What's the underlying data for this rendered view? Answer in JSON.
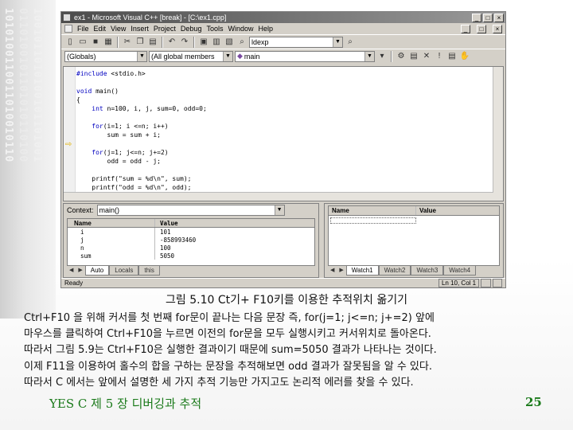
{
  "decoration": {
    "strip1": "1010100110011010010110",
    "strip2": "0110100101101010110100",
    "strip3": "1001011010100101101001"
  },
  "ide": {
    "title": "ex1 - Microsoft Visual C++ [break] - [C:\\ex1.cpp]",
    "menu": [
      "File",
      "Edit",
      "View",
      "Insert",
      "Project",
      "Debug",
      "Tools",
      "Window",
      "Help"
    ],
    "find_combo": "ldexp",
    "scope_combo": "(Globals)",
    "members_combo": "(All global members",
    "function_combo": "main",
    "code_lines": [
      "#include <stdio.h>",
      "",
      "void main()",
      "{",
      "    int n=100, i, j, sum=0, odd=0;",
      "",
      "    for(i=1; i <=n; i++)",
      "        sum = sum + i;",
      "",
      "    for(j=1; j<=n; j+=2)",
      "        odd = odd - j;",
      "",
      "    printf(\"sum = %d\\n\", sum);",
      "    printf(\"odd = %d\\n\", odd);"
    ],
    "context_label": "Context:",
    "context_value": "main()",
    "vars_headers": [
      "Name",
      "Value"
    ],
    "vars": [
      {
        "name": "i",
        "value": "101"
      },
      {
        "name": "j",
        "value": "-858993460"
      },
      {
        "name": "n",
        "value": "100"
      },
      {
        "name": "sum",
        "value": "5050"
      }
    ],
    "vars_tabs": [
      "Auto",
      "Locals",
      "this"
    ],
    "watch_headers": [
      "Name",
      "Value"
    ],
    "watch_tabs": [
      "Watch1",
      "Watch2",
      "Watch3",
      "Watch4"
    ],
    "status_left": "Ready",
    "status_pos": "Ln 10, Col 1"
  },
  "caption": "그림 5.10 Ct기+ F10키를 이용한 추적위치 옮기기",
  "paragraphs": [
    "Ctrl+F10 을 위해 커서를 첫 번째 for문이 끝나는 다음 문장 즉, for(j=1; j<=n; j+=2) 앞에",
    "마우스를 클릭하여 Ctrl+F10을 누르면 이전의 for문을 모두 실행시키고 커서위치로 돌아온다.",
    "따라서 그림 5.9는 Ctrl+F10은 실행한 결과이기 때문에 sum=5050 결과가 나타나는 것이다.",
    "이제 F11을 이용하여 홀수의 합을 구하는 문장을 추적해보면 odd 결과가 잘못됨을 알 수 있다.",
    "따라서 C 에서는 앞에서 설명한 세 가지 추적 기능만 가지고도 논리적 에러를 찾을 수 있다."
  ],
  "footer": "YES C  제 5 장 디버깅과 추적",
  "page_number": "25"
}
